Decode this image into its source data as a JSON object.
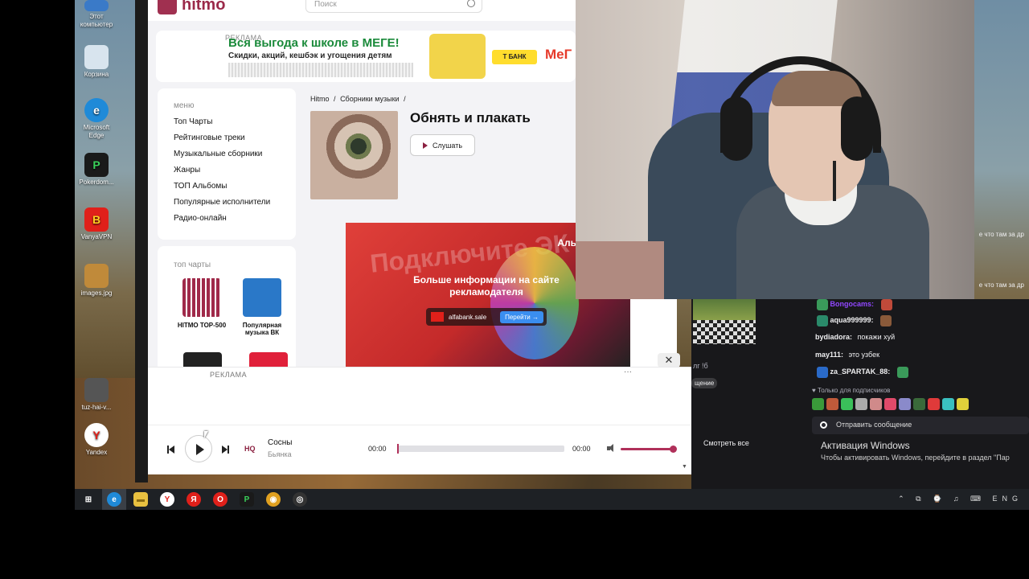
{
  "desktop_icons": [
    {
      "label": "Этот компьютер",
      "color": "#3a7ac8"
    },
    {
      "label": "Корзина",
      "color": "#d8e4ee"
    },
    {
      "label": "Microsoft Edge",
      "color": "#1f8ad8"
    },
    {
      "label": "Pokerdom...",
      "color": "#1a1a1a"
    },
    {
      "label": "VanyaVPN",
      "color": "#e0201a"
    },
    {
      "label": "images.jpg",
      "color": "#c08a3a"
    },
    {
      "label": "tuz-hai-v...",
      "color": "#555555"
    },
    {
      "label": "Yandex",
      "color": "#ffffff"
    }
  ],
  "site": {
    "logo_text": "hitmo",
    "search_placeholder": "Поиск",
    "top_ad": {
      "label": "РЕКЛАМА",
      "title": "Вся выгода к школе в МЕГЕ!",
      "subtitle": "Скидки, акций, кешбэк и угощения детям",
      "tbank": "Т БАНК",
      "mega": "МеГ"
    },
    "menu": {
      "section_title": "меню",
      "items": [
        "Топ Чарты",
        "Рейтинговые треки",
        "Музыкальные сборники",
        "Жанры",
        "ТОП Альбомы",
        "Популярные исполнители",
        "Радио-онлайн"
      ]
    },
    "top_charts": {
      "section_title": "топ чарты",
      "tiles": [
        {
          "label": "HITMO TOP-500"
        },
        {
          "label": "Популярная музыка ВК"
        }
      ]
    },
    "breadcrumb": [
      "Hitmo",
      "/",
      "Сборники музыки",
      "/"
    ],
    "album": {
      "title": "Обнять и плакать",
      "listen_label": "Слушать"
    },
    "side_ad": {
      "big_text": "Подключите ЭК",
      "brand": "Аль",
      "info": "Больше информации на сайте рекламодателя",
      "domain": "alfabank.sale",
      "go_label": "Перейти →"
    },
    "bottom_ad": {
      "label": "РЕКЛАМА",
      "more": "···",
      "close": "✕"
    },
    "player": {
      "hq": "HQ",
      "track_title": "Сосны",
      "artist": "Бьянка",
      "time_current": "00:00",
      "time_total": "00:00",
      "progress": 0,
      "volume": 1.0
    }
  },
  "stream": {
    "mid_text": "лг !б",
    "mid_badge": "щение",
    "watch_all": "Смотреть все",
    "chat": [
      {
        "user": "Bongocams:",
        "text": "",
        "color": "#9147ff"
      },
      {
        "user": "aqua999999:",
        "text": "",
        "color": "#ffffff"
      },
      {
        "user": "bydiadora:",
        "text": "покажи хуй",
        "color": "#ffffff"
      },
      {
        "user": "may111:",
        "text": "это узбек",
        "color": "#ffffff"
      },
      {
        "user": "za_SPARTAK_88:",
        "text": "",
        "color": "#ffffff"
      }
    ],
    "right_cut_lines": [
      "е что там за др",
      "е что там за др"
    ],
    "subscribers_only": "♥ Только для подписчиков",
    "send_placeholder": "Отправить сообщение",
    "windows_activation": {
      "title": "Активация Windows",
      "subtitle": "Чтобы активировать Windows, перейдите в раздел \"Пар"
    }
  },
  "taskbar": {
    "items": [
      {
        "name": "windows-start-icon",
        "color": "#ffffff",
        "glyph": "⊞"
      },
      {
        "name": "edge-icon",
        "color": "#1f8ad8",
        "glyph": "e"
      },
      {
        "name": "explorer-icon",
        "color": "#e8c040",
        "glyph": "▬"
      },
      {
        "name": "yandex-icon",
        "color": "#ffffff",
        "glyph": "Y"
      },
      {
        "name": "yandex-browser-icon",
        "color": "#e0201a",
        "glyph": "Я"
      },
      {
        "name": "opera-icon",
        "color": "#e0201a",
        "glyph": "O"
      },
      {
        "name": "pokerdom-icon",
        "color": "#1a1a1a",
        "glyph": "P"
      },
      {
        "name": "chrome-icon",
        "color": "#e0a020",
        "glyph": "◉"
      },
      {
        "name": "obs-icon",
        "color": "#333333",
        "glyph": "◎"
      }
    ],
    "tray_text": "⌃ ⧉ ⌚ ♫ ⌨ ENG"
  }
}
